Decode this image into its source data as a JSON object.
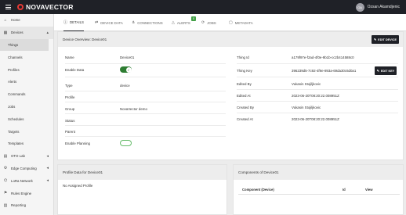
{
  "app": {
    "name": "NOVAVECTOR",
    "user_initials": "OA",
    "user_name": "Ozsan Akamdjenic"
  },
  "colors": {
    "accent": "#1f2127",
    "toggle_on": "#2e7d32",
    "toggle_off_border": "#66bb6a",
    "badge": "#43a047"
  },
  "sidebar": {
    "items": [
      {
        "label": "Home",
        "icon": "home-icon"
      },
      {
        "label": "Devices",
        "icon": "devices-icon",
        "expanded": true
      },
      {
        "label": "Things",
        "sub": true,
        "active": true
      },
      {
        "label": "Channels",
        "sub": true
      },
      {
        "label": "Profiles",
        "sub": true
      },
      {
        "label": "Alerts",
        "sub": true
      },
      {
        "label": "Commands",
        "sub": true
      },
      {
        "label": "Jobs",
        "sub": true
      },
      {
        "label": "Schedules",
        "sub": true
      },
      {
        "label": "Targets",
        "sub": true
      },
      {
        "label": "Templates",
        "sub": true
      },
      {
        "label": "OTO Lab",
        "icon": "lab-icon"
      },
      {
        "label": "Edge Computing",
        "icon": "edge-icon"
      },
      {
        "label": "LoRa Network",
        "icon": "network-icon"
      },
      {
        "label": "Rules Engine",
        "icon": "rules-icon"
      },
      {
        "label": "Reporting",
        "icon": "report-icon"
      }
    ]
  },
  "tabs": [
    {
      "label": "DETAILS",
      "icon": "info-icon",
      "active": true
    },
    {
      "label": "DEVICE DATA",
      "icon": "data-icon"
    },
    {
      "label": "CONNECTIONS",
      "icon": "connections-icon"
    },
    {
      "label": "ALERTS",
      "icon": "alert-icon",
      "badge": "0"
    },
    {
      "label": "JOBS",
      "icon": "jobs-icon"
    },
    {
      "label": "METADATA",
      "icon": "metadata-icon"
    }
  ],
  "overview": {
    "title": "Device Overview: Device01",
    "edit_button": "EDIT DEVICE",
    "left": [
      {
        "label": "Name",
        "value": "Device01"
      },
      {
        "label": "Enable Data",
        "value": "",
        "toggle": "on"
      },
      {
        "label": "Type",
        "value": "device"
      },
      {
        "label": "Profile",
        "value": ""
      },
      {
        "label": "Group",
        "value": "NovaVector demo"
      },
      {
        "label": "Status",
        "value": ""
      },
      {
        "label": "Parent",
        "value": ""
      },
      {
        "label": "Enable Planning",
        "value": "",
        "toggle": "off"
      }
    ],
    "right": [
      {
        "label": "Thing Id",
        "value": "a179f97e-f2ad-4f0e-9b1b-cc2b414588c0"
      },
      {
        "label": "Thing Key",
        "value": "396239d5-7c92-4f9e-893a-69da30c6d0a1",
        "button": "EDIT KEY"
      },
      {
        "label": "Edited By",
        "value": "Vukasin Stojiljkovic"
      },
      {
        "label": "Edited At",
        "value": "2023-06-20T08:20:22.008951Z"
      },
      {
        "label": "Created By",
        "value": "Vukasin Stojiljkovic"
      },
      {
        "label": "Created At",
        "value": "2023-06-20T08:20:22.008951Z"
      }
    ]
  },
  "profile_data": {
    "title": "Profile Data for Device01",
    "empty_text": "No Assigned Profile"
  },
  "components": {
    "title": "Components of Device01",
    "columns": [
      "Component (Device)",
      "Id",
      "View"
    ]
  }
}
